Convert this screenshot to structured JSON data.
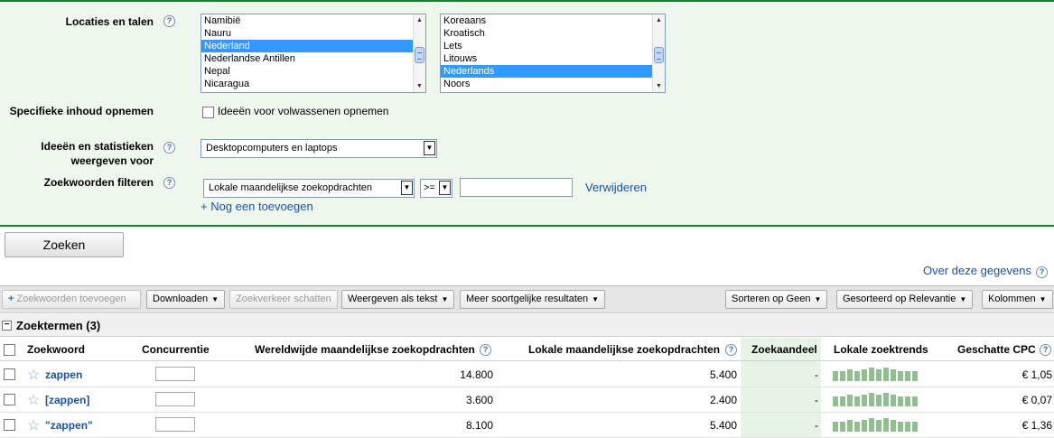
{
  "options": {
    "locations_label": "Locaties en talen",
    "countries": [
      "Namibië",
      "Nauru",
      "Nederland",
      "Nederlandse Antillen",
      "Nepal",
      "Nicaragua"
    ],
    "selected_country": "Nederland",
    "languages": [
      "Koreaans",
      "Kroatisch",
      "Lets",
      "Litouws",
      "Nederlands",
      "Noors"
    ],
    "selected_language": "Nederlands",
    "specific_content_label": "Specifieke inhoud opnemen",
    "adult_ideas_label": "Ideeën voor volwassenen opnemen",
    "adult_ideas_checked": false,
    "show_for_label": "Ideeën en statistieken weergeven voor",
    "show_for_value": "Desktopcomputers en laptops",
    "filter_label": "Zoekwoorden filteren",
    "filter_field": "Lokale maandelijkse zoekopdrachten",
    "filter_operator": ">=",
    "filter_value": "",
    "remove_link": "Verwijderen",
    "add_another_link": "+ Nog een toevoegen",
    "help_glyph": "?"
  },
  "search_button": "Zoeken",
  "about_link": "Over deze gegevens",
  "toolbar": {
    "add_keywords": "Zoekwoorden toevoegen",
    "download": "Downloaden",
    "estimate_traffic": "Zoekverkeer schatten",
    "view_as_text": "Weergeven als tekst",
    "more_like_these": "Meer soortgelijke resultaten",
    "sort_by": "Sorteren op Geen",
    "sorted_by": "Gesorteerd op Relevantie",
    "columns": "Kolommen"
  },
  "group_title": "Zoektermen (3)",
  "table": {
    "headers": {
      "keyword": "Zoekwoord",
      "competition": "Concurrentie",
      "global_monthly": "Wereldwijde maandelijkse zoekopdrachten",
      "local_monthly": "Lokale maandelijkse zoekopdrachten",
      "ad_share": "Zoekaandeel",
      "local_trends": "Lokale zoektrends",
      "approx_cpc": "Geschatte CPC"
    },
    "rows": [
      {
        "keyword": "zappen",
        "global": "14.800",
        "local": "5.400",
        "share": "-",
        "cpc": "€ 1,05",
        "trend": [
          0.75,
          0.75,
          0.85,
          0.75,
          0.85,
          1.0,
          0.85,
          1.0,
          0.85,
          0.75,
          0.75,
          0.75
        ]
      },
      {
        "keyword": "[zappen]",
        "global": "3.600",
        "local": "2.400",
        "share": "-",
        "cpc": "€ 0,07",
        "trend": [
          0.75,
          0.75,
          0.85,
          0.75,
          0.85,
          1.0,
          0.85,
          1.0,
          0.85,
          0.75,
          0.75,
          0.75
        ]
      },
      {
        "keyword": "\"zappen\"",
        "global": "8.100",
        "local": "5.400",
        "share": "-",
        "cpc": "€ 1,36",
        "trend": [
          0.75,
          0.75,
          0.85,
          0.75,
          0.85,
          1.0,
          0.85,
          1.0,
          0.85,
          0.75,
          0.75,
          0.75
        ]
      }
    ]
  },
  "colors": {
    "accent_green": "#1e7b34",
    "link_blue": "#1a53a6",
    "trend_green": "#8fbe8f"
  }
}
